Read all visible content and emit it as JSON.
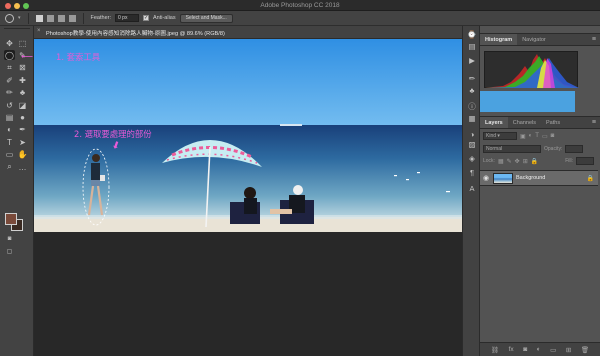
{
  "window": {
    "title": "Adobe Photoshop CC 2018",
    "traffic_lights": [
      "#ed6a5e",
      "#f5bf4f",
      "#61c554"
    ]
  },
  "options_bar": {
    "feather_label": "Feather:",
    "feather_value": "0 px",
    "antialias_label": "Anti-alias",
    "antialias_checked": true,
    "select_mask_button": "Select and Mask..."
  },
  "document": {
    "tab_title": "Photoshop教學-使用內容感知消除路人贓物-原圖.jpeg @ 89.6% (RGB/8)",
    "close_glyph": "×"
  },
  "annotations": {
    "step1": "1. 套索工具",
    "step2": "2. 選取要處理的部份",
    "color": "#e85bd7"
  },
  "toolbar": {
    "tools": [
      {
        "icon": "move-icon",
        "glyph": "✥"
      },
      {
        "icon": "marquee-icon",
        "glyph": "⬚"
      },
      {
        "icon": "lasso-icon",
        "glyph": "◯",
        "active": true
      },
      {
        "icon": "quick-select-icon",
        "glyph": "✎"
      },
      {
        "icon": "crop-icon",
        "glyph": "⌗"
      },
      {
        "icon": "frame-icon",
        "glyph": "⊠"
      },
      {
        "icon": "eyedropper-icon",
        "glyph": "✐"
      },
      {
        "icon": "healing-icon",
        "glyph": "✚"
      },
      {
        "icon": "brush-icon",
        "glyph": "✏"
      },
      {
        "icon": "stamp-icon",
        "glyph": "♣"
      },
      {
        "icon": "history-brush-icon",
        "glyph": "↺"
      },
      {
        "icon": "eraser-icon",
        "glyph": "◪"
      },
      {
        "icon": "gradient-icon",
        "glyph": "▤"
      },
      {
        "icon": "blur-icon",
        "glyph": "●"
      },
      {
        "icon": "dodge-icon",
        "glyph": "◐"
      },
      {
        "icon": "pen-icon",
        "glyph": "✒"
      },
      {
        "icon": "type-icon",
        "glyph": "T"
      },
      {
        "icon": "path-select-icon",
        "glyph": "➤"
      },
      {
        "icon": "shape-icon",
        "glyph": "▭"
      },
      {
        "icon": "hand-icon",
        "glyph": "✋"
      },
      {
        "icon": "zoom-icon",
        "glyph": "⌕"
      },
      {
        "icon": "more-tools-icon",
        "glyph": "…"
      }
    ],
    "foreground_color": "#7a4a3a",
    "background_color": "#3a2a22"
  },
  "right_strip": {
    "icons": [
      "history-icon",
      "actions-icon",
      "adjust-icon",
      "brush-panel-icon",
      "clone-source-icon",
      "glyph-icon",
      "paragraph-icon",
      "layer-comps-icon",
      "libraries-icon",
      "properties-icon",
      "info-icon"
    ]
  },
  "histogram_panel": {
    "tabs": [
      "Histogram",
      "Navigator"
    ],
    "active": "Histogram",
    "menu_glyph": "≡"
  },
  "layers_panel": {
    "tabs": [
      "Layers",
      "Channels",
      "Paths"
    ],
    "active": "Layers",
    "menu_glyph": "≡",
    "kind_label": "Kind",
    "blend_mode": "Normal",
    "opacity_label": "Opacity:",
    "lock_label": "Lock:",
    "fill_label": "Fill:",
    "layers": [
      {
        "name": "Background",
        "visible": true,
        "locked": true
      }
    ],
    "footer_icons": [
      "link-icon",
      "fx-icon",
      "mask-icon",
      "adjustment-icon",
      "group-icon",
      "new-layer-icon",
      "trash-icon"
    ]
  }
}
